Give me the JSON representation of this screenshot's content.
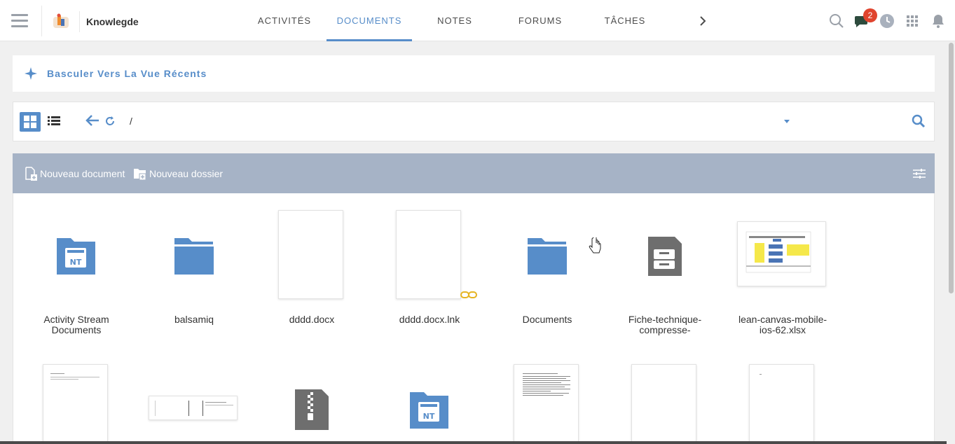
{
  "header": {
    "space_name": "Knowlegde",
    "tabs": [
      {
        "label": "ACTIVITÉS"
      },
      {
        "label": "DOCUMENTS"
      },
      {
        "label": "NOTES"
      },
      {
        "label": "FORUMS"
      },
      {
        "label": "TÂCHES"
      }
    ],
    "active_tab": "DOCUMENTS",
    "notification_count": "2",
    "icons": [
      "hamburger-menu-icon",
      "search-icon",
      "chat-icon",
      "clock-icon",
      "apps-grid-icon",
      "bell-icon"
    ]
  },
  "recent": {
    "label": "Basculer Vers La Vue Récents",
    "icon": "sparkle-icon"
  },
  "toolbar": {
    "path": "/",
    "icons": [
      "grid-view-icon",
      "list-view-icon",
      "back-arrow-icon",
      "refresh-icon",
      "dropdown-caret-icon",
      "search-icon"
    ]
  },
  "actions": {
    "new_document": "Nouveau document",
    "new_folder": "Nouveau dossier"
  },
  "items_row1": [
    {
      "name": "Activity Stream Documents",
      "kind": "nt-folder"
    },
    {
      "name": "balsamiq",
      "kind": "folder"
    },
    {
      "name": "dddd.docx",
      "kind": "blank-doc"
    },
    {
      "name": "dddd.docx.lnk",
      "kind": "blank-doc-link"
    },
    {
      "name": "Documents",
      "kind": "folder"
    },
    {
      "name": "Fiche-technique-compresse-",
      "kind": "archive"
    },
    {
      "name": "lean-canvas-mobile-ios-62.xlsx",
      "kind": "spreadsheet-thumb"
    }
  ],
  "items_row2": [
    {
      "kind": "text-doc"
    },
    {
      "kind": "landscape-doc"
    },
    {
      "kind": "zip"
    },
    {
      "kind": "nt-folder"
    },
    {
      "kind": "dense-text-doc"
    },
    {
      "kind": "blank-doc"
    },
    {
      "kind": "blank-doc"
    }
  ],
  "colors": {
    "accent": "#578dc9",
    "action_bar": "#a6b3c6",
    "badge": "#e0442e",
    "link_badge": "#e6b422"
  }
}
